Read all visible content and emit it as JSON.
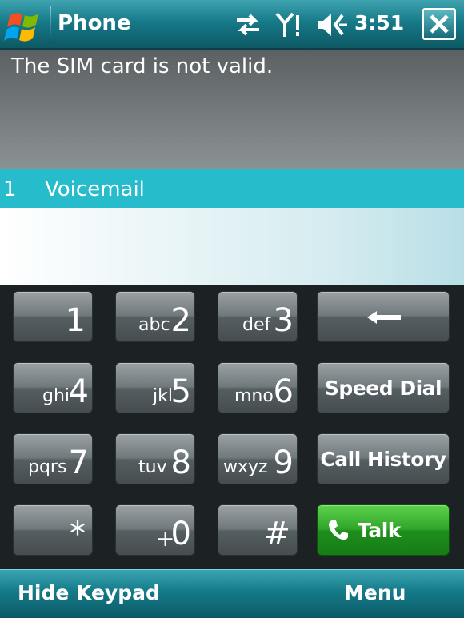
{
  "titlebar": {
    "app_title": "Phone",
    "time": "3:51",
    "icons": {
      "start": "windows-flag-icon",
      "connectivity": "sync-arrows-icon",
      "signal": "signal-antenna-icon",
      "volume": "speaker-volume-icon",
      "close": "close-icon"
    }
  },
  "message": {
    "text": "The SIM card is not valid."
  },
  "results": [
    {
      "number": "1",
      "name": "Voicemail"
    }
  ],
  "keypad": {
    "keys": [
      {
        "digit": "1",
        "letters": ""
      },
      {
        "digit": "2",
        "letters": "abc"
      },
      {
        "digit": "3",
        "letters": "def"
      },
      {
        "digit": "4",
        "letters": "ghi"
      },
      {
        "digit": "5",
        "letters": "jkl"
      },
      {
        "digit": "6",
        "letters": "mno"
      },
      {
        "digit": "7",
        "letters": "pqrs"
      },
      {
        "digit": "8",
        "letters": "tuv"
      },
      {
        "digit": "9",
        "letters": "wxyz"
      },
      {
        "digit": "*",
        "letters": ""
      },
      {
        "digit": "0",
        "letters": "+"
      },
      {
        "digit": "#",
        "letters": ""
      }
    ],
    "backspace_icon": "backspace-arrow-icon",
    "speed_dial": "Speed Dial",
    "call_history": "Call History",
    "talk": "Talk",
    "talk_icon": "phone-handset-icon"
  },
  "softkeys": {
    "left": "Hide Keypad",
    "right": "Menu"
  },
  "colors": {
    "accent": "#27bccb",
    "talk": "#2fa52a",
    "titlebar": "#177a88"
  }
}
